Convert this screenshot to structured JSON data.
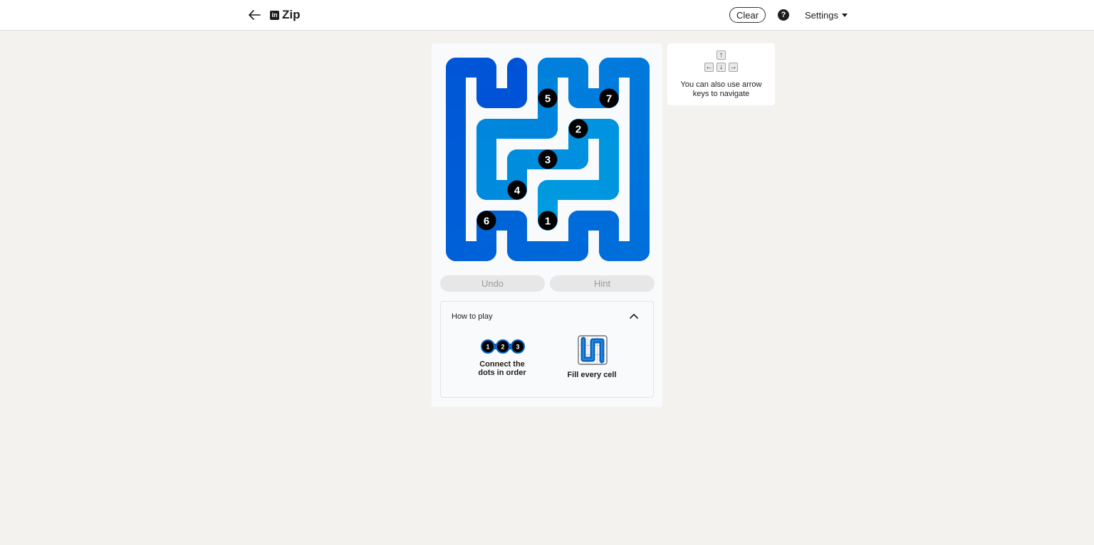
{
  "header": {
    "brand_icon": "in",
    "title": "Zip",
    "clear_label": "Clear",
    "help_label": "?",
    "settings_label": "Settings"
  },
  "puzzle": {
    "grid_size": 6,
    "numbers": [
      {
        "label": "1",
        "row": 5,
        "col": 3
      },
      {
        "label": "2",
        "row": 2,
        "col": 4
      },
      {
        "label": "3",
        "row": 3,
        "col": 3
      },
      {
        "label": "4",
        "row": 4,
        "col": 2
      },
      {
        "label": "5",
        "row": 1,
        "col": 3
      },
      {
        "label": "6",
        "row": 5,
        "col": 1
      },
      {
        "label": "7",
        "row": 1,
        "col": 5
      }
    ],
    "path": [
      [
        5,
        3
      ],
      [
        4,
        3
      ],
      [
        4,
        4
      ],
      [
        4,
        5
      ],
      [
        3,
        5
      ],
      [
        2,
        5
      ],
      [
        2,
        4
      ],
      [
        3,
        4
      ],
      [
        3,
        3
      ],
      [
        3,
        2
      ],
      [
        4,
        2
      ],
      [
        4,
        1
      ],
      [
        3,
        1
      ],
      [
        2,
        1
      ],
      [
        2,
        2
      ],
      [
        2,
        3
      ],
      [
        1,
        3
      ],
      [
        0,
        3
      ],
      [
        0,
        4
      ],
      [
        1,
        4
      ],
      [
        1,
        5
      ],
      [
        0,
        5
      ],
      [
        0,
        6
      ],
      [
        1,
        6
      ],
      [
        2,
        6
      ],
      [
        3,
        6
      ],
      [
        4,
        6
      ],
      [
        5,
        6
      ],
      [
        6,
        6
      ],
      [
        6,
        5
      ],
      [
        5,
        5
      ],
      [
        5,
        4
      ],
      [
        6,
        4
      ],
      [
        6,
        3
      ],
      [
        6,
        2
      ],
      [
        5,
        2
      ],
      [
        5,
        1
      ],
      [
        6,
        1
      ],
      [
        6,
        0
      ],
      [
        5,
        0
      ],
      [
        4,
        0
      ],
      [
        3,
        0
      ],
      [
        2,
        0
      ],
      [
        1,
        0
      ],
      [
        0,
        0
      ],
      [
        0,
        1
      ],
      [
        1,
        1
      ],
      [
        1,
        2
      ],
      [
        0,
        2
      ]
    ],
    "colors": {
      "start": "#009be0",
      "end": "#0050d6",
      "dot": "#000000",
      "dot_text": "#ffffff"
    }
  },
  "controls": {
    "undo_label": "Undo",
    "hint_label": "Hint"
  },
  "how_to_play": {
    "title": "How to play",
    "rules": [
      {
        "line1": "Connect the",
        "line2": "dots in order"
      },
      {
        "line1": "Fill every cell"
      }
    ],
    "example_dots": [
      "1",
      "2",
      "3"
    ]
  },
  "navigation_tip": {
    "keys": {
      "up": "↑",
      "left": "←",
      "down": "↓",
      "right": "→"
    },
    "line1": "You can also use arrow",
    "line2": "keys to navigate"
  }
}
